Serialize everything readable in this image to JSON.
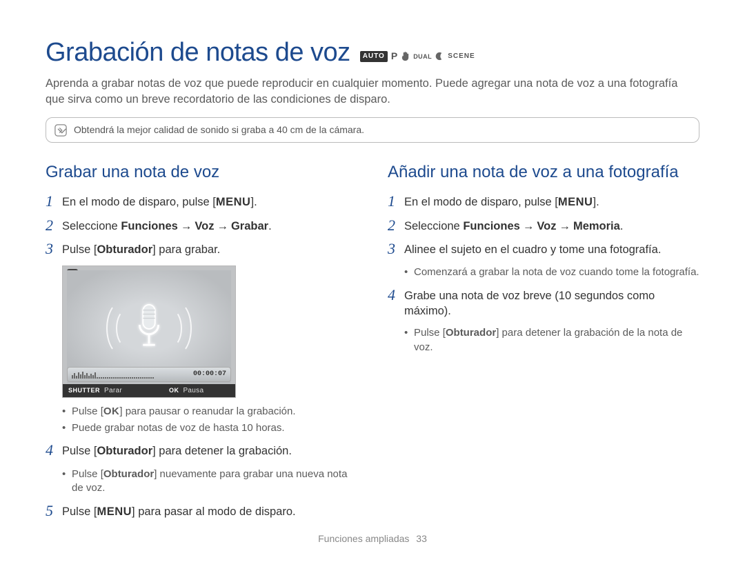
{
  "title": "Grabación de notas de voz",
  "modes": {
    "auto": "AUTO",
    "p": "P",
    "dual": "DUAL",
    "scene": "SCENE"
  },
  "intro": "Aprenda a grabar notas de voz que puede reproducir en cualquier momento. Puede agregar una nota de voz a una fotografía que sirva como un breve recordatorio de las condiciones de disparo.",
  "note": "Obtendrá la mejor calidad de sonido si graba a 40 cm de la cámara.",
  "left": {
    "heading": "Grabar una nota de voz",
    "s1a": "En el modo de disparo, pulse [",
    "menu": "MENU",
    "s1b": "].",
    "s2a": "Seleccione ",
    "s2b": "Funciones",
    "s2arrow": "→",
    "s2c": "Voz",
    "s2d": "Grabar",
    "s2e": ".",
    "s3a": "Pulse [",
    "s3b": "Obturador",
    "s3c": "] para grabar.",
    "lcd": {
      "counter": "00:00:07",
      "shutter_key": "SHUTTER",
      "shutter_lbl": "Parar",
      "ok_key": "OK",
      "ok_lbl": "Pausa"
    },
    "bul1a": "Pulse [",
    "bul1b": "OK",
    "bul1c": "] para pausar o reanudar la grabación.",
    "bul2": "Puede grabar notas de voz de hasta 10 horas.",
    "s4a": "Pulse [",
    "s4b": "Obturador",
    "s4c": "] para detener la grabación.",
    "bul3a": "Pulse [",
    "bul3b": "Obturador",
    "bul3c": "] nuevamente para grabar una nueva nota de voz.",
    "s5a": "Pulse [",
    "s5b": "MENU",
    "s5c": "] para pasar al modo de disparo."
  },
  "right": {
    "heading": "Añadir una nota de voz a una fotografía",
    "s1a": "En el modo de disparo, pulse [",
    "menu": "MENU",
    "s1b": "].",
    "s2a": "Seleccione ",
    "s2b": "Funciones",
    "s2arrow": "→",
    "s2c": "Voz",
    "s2d": "Memoria",
    "s2e": ".",
    "s3": "Alinee el sujeto en el cuadro y tome una fotografía.",
    "bul1": "Comenzará a grabar la nota de voz cuando tome la fotografía.",
    "s4": "Grabe una nota de voz breve (10 segundos como máximo).",
    "bul2a": "Pulse [",
    "bul2b": "Obturador",
    "bul2c": "] para detener la grabación de la nota de voz."
  },
  "footer": {
    "section": "Funciones ampliadas",
    "page": "33"
  }
}
